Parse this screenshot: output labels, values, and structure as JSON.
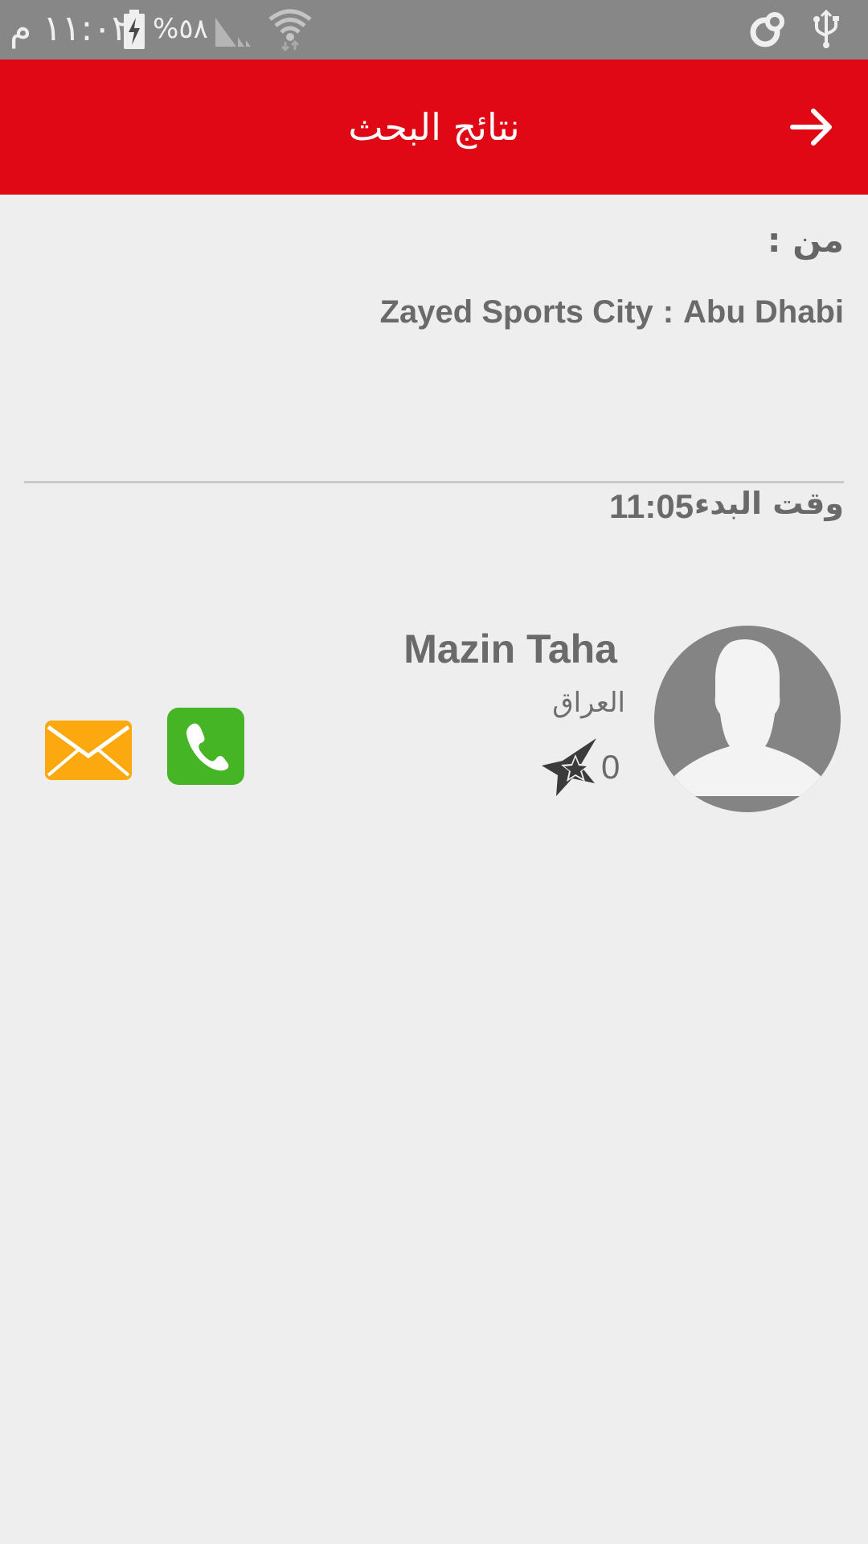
{
  "status_bar": {
    "time": "١١:٠٢ م",
    "battery_percent": "%٥٨",
    "icons": [
      "battery-charging-icon",
      "signal-icon",
      "wifi-icon",
      "sync-icon",
      "usb-icon"
    ]
  },
  "app_bar": {
    "title": "نتائج البحث",
    "back_icon": "arrow-right-icon",
    "color": "#e10816"
  },
  "trip": {
    "from_label": "من :",
    "from_place": "Zayed Sports City",
    "separator": ":",
    "from_city": "Abu Dhabi",
    "start_time_label": "وقت البدء",
    "start_time_value": "11:05"
  },
  "driver": {
    "name": "Mazin Taha",
    "country": "العراق",
    "rating": "0",
    "avatar_icon": "person-placeholder-icon",
    "rating_icon": "star-icon"
  },
  "actions": {
    "call_icon": "phone-icon",
    "email_icon": "envelope-icon",
    "call_color": "#45b525",
    "email_color": "#fba90e"
  }
}
